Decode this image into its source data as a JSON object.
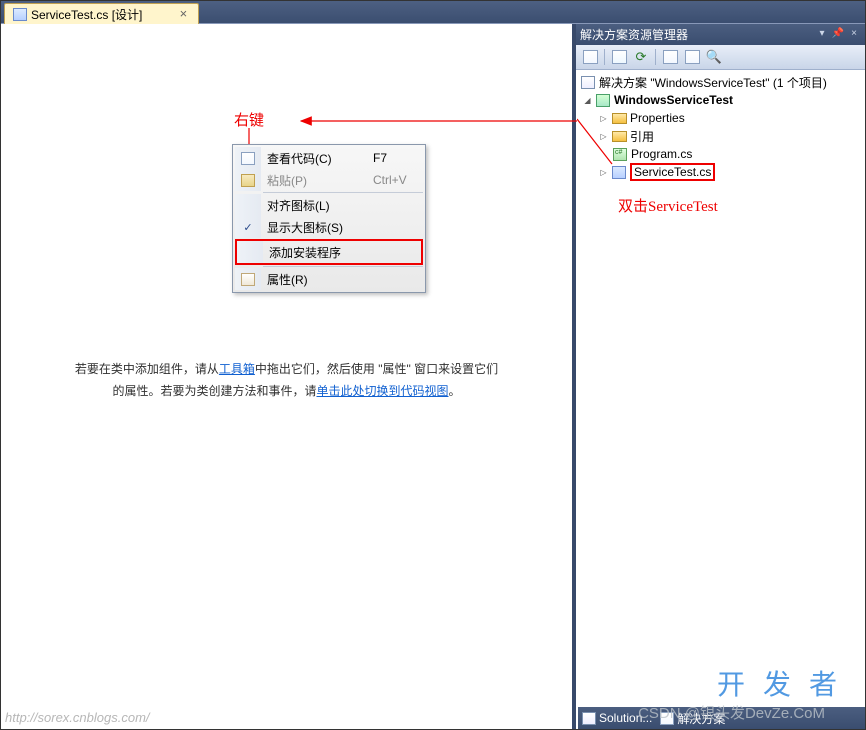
{
  "tab": {
    "title": "ServiceTest.cs [设计]"
  },
  "context_menu": {
    "items": [
      {
        "label": "查看代码(C)",
        "shortcut": "F7",
        "enabled": true,
        "icon": "code-icon"
      },
      {
        "label": "粘贴(P)",
        "shortcut": "Ctrl+V",
        "enabled": false,
        "icon": "paste-icon"
      },
      {
        "sep": true
      },
      {
        "label": "对齐图标(L)",
        "shortcut": "",
        "enabled": true
      },
      {
        "label": "显示大图标(S)",
        "shortcut": "",
        "enabled": true,
        "checked": true
      },
      {
        "label": "添加安装程序",
        "shortcut": "",
        "enabled": true,
        "highlight": true
      },
      {
        "sep": true
      },
      {
        "label": "属性(R)",
        "shortcut": "",
        "enabled": true,
        "icon": "properties-icon"
      }
    ]
  },
  "designer_hint": {
    "line1_pre": "若要在类中添加组件，请从",
    "line1_link": "工具箱",
    "line1_post": "中拖出它们，然后使用 \"属性\" 窗口来设置它们",
    "line2_pre": "的属性。若要为类创建方法和事件，请",
    "line2_link": "单击此处切换到代码视图",
    "line2_post": "。"
  },
  "solution_explorer": {
    "title": "解决方案资源管理器",
    "solution_label": "解决方案 \"WindowsServiceTest\" (1 个项目)",
    "project": "WindowsServiceTest",
    "nodes": {
      "properties": "Properties",
      "references": "引用",
      "program": "Program.cs",
      "servicetest": "ServiceTest.cs"
    }
  },
  "annotations": {
    "right_click": "右键",
    "double_click": "双击ServiceTest"
  },
  "status": {
    "solution": "Solution...",
    "solution_full": "解决方案"
  },
  "watermarks": {
    "url": "http://sorex.cnblogs.com/",
    "dev": "开发者",
    "csdn": "CSDN @银头发DevZe.CoM"
  }
}
